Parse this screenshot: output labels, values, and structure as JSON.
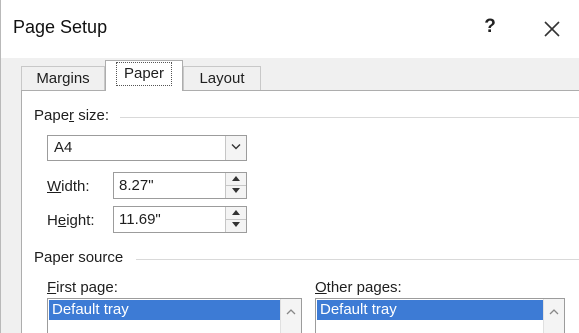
{
  "window": {
    "title": "Page Setup",
    "help_label": "?"
  },
  "tabs": [
    {
      "label": "Margins",
      "active": false
    },
    {
      "label": "Paper",
      "active": true
    },
    {
      "label": "Layout",
      "active": false
    }
  ],
  "paper_size": {
    "group_prefix": "Pape",
    "group_mnemonic": "r",
    "group_suffix": " size:",
    "selected": "A4",
    "width": {
      "label_mnemonic": "W",
      "label_rest": "idth:",
      "value": "8.27\""
    },
    "height": {
      "label_prefix": "H",
      "label_mnemonic": "e",
      "label_rest": "ight:",
      "value": "11.69\""
    }
  },
  "paper_source": {
    "group_label": "Paper source",
    "first_page": {
      "label_mnemonic": "F",
      "label_rest": "irst page:",
      "selected_item": "Default tray"
    },
    "other_pages": {
      "label_mnemonic": "O",
      "label_rest": "ther pages:",
      "selected_item": "Default tray"
    }
  },
  "colors": {
    "selection": "#3d7bd5",
    "panel_background": "#ffffff",
    "dialog_background": "#f0f0f0"
  },
  "icons": {
    "close": "close-icon",
    "combo_arrow": "chevron-down-icon",
    "spin_up": "triangle-up-icon",
    "spin_down": "triangle-down-icon",
    "scroll_up": "chevron-up-icon"
  }
}
